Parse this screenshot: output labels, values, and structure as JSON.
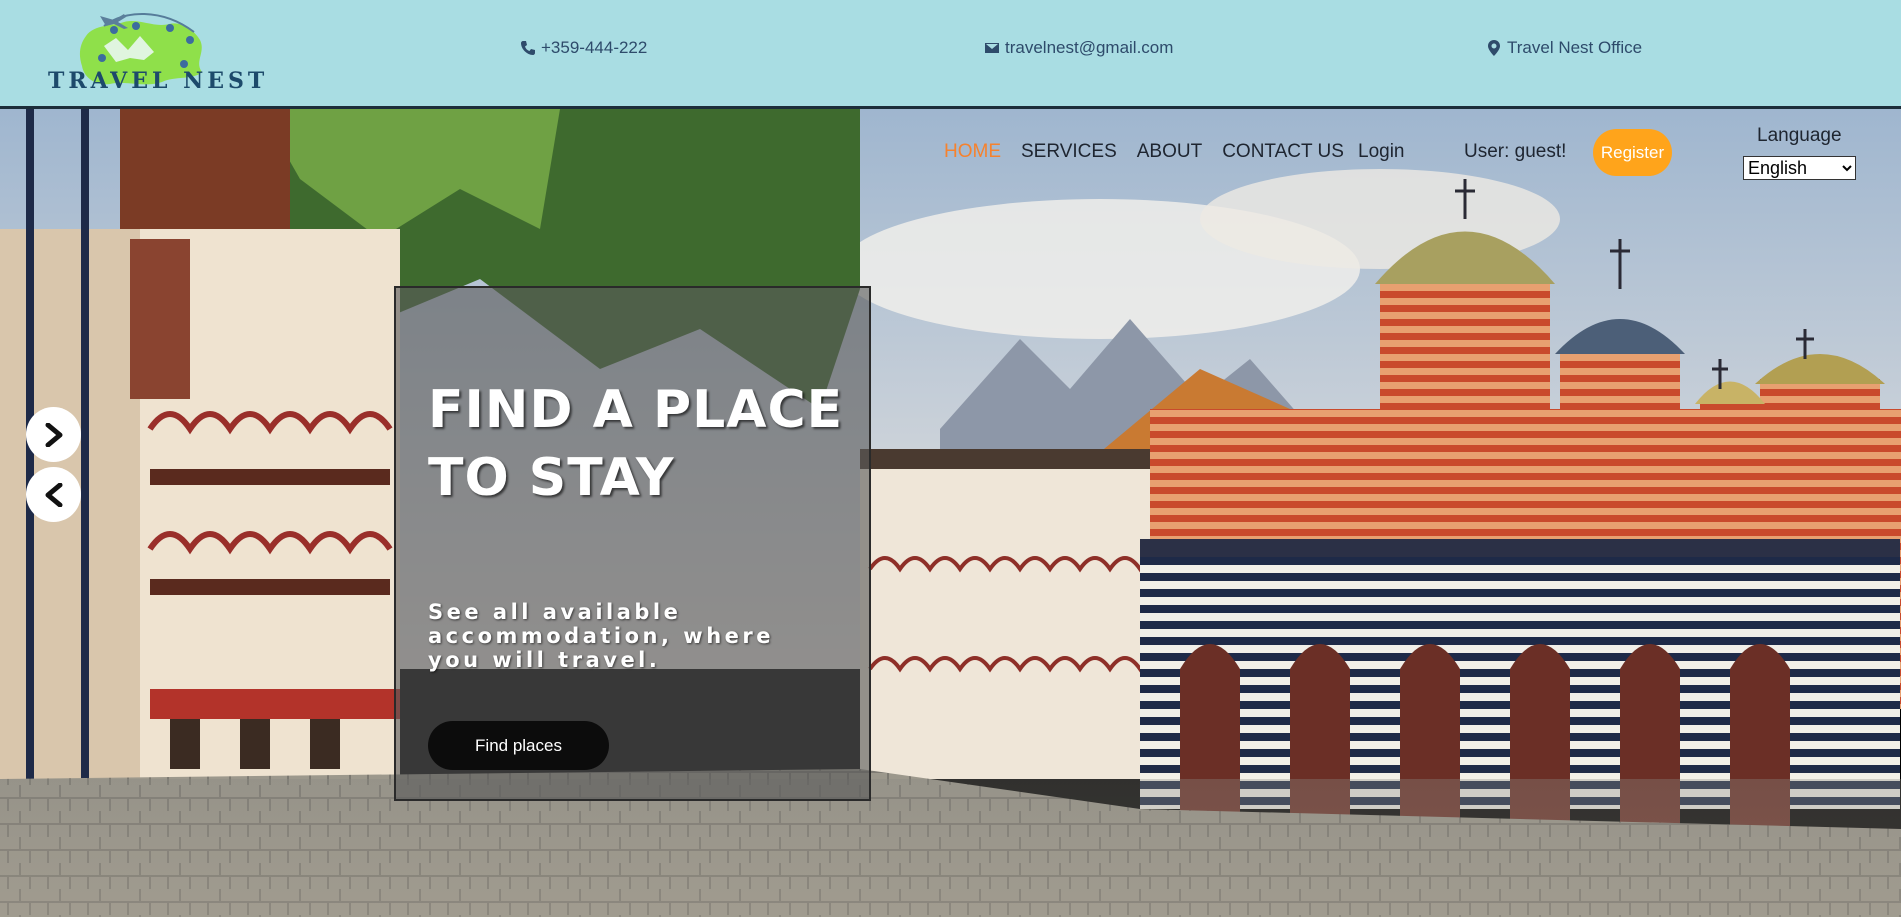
{
  "brand": {
    "name": "TRAVEL NEST"
  },
  "contacts": {
    "phone": "+359-444-222",
    "email": "travelnest@gmail.com",
    "office": "Travel Nest Office"
  },
  "nav": {
    "items": [
      "HOME",
      "SERVICES",
      "ABOUT",
      "CONTACT US"
    ],
    "active": "HOME",
    "login": "Login",
    "user": "User: guest!",
    "register": "Register"
  },
  "language": {
    "label": "Language",
    "selected": "English"
  },
  "hero": {
    "title_line1": "FIND A PLACE",
    "title_line2": "TO STAY",
    "subtitle_line1": "See all available",
    "subtitle_line2": "accommodation, where",
    "subtitle_line3": "you will travel.",
    "button": "Find places"
  },
  "icons": {
    "phone": "phone-icon",
    "email": "envelope-icon",
    "office": "map-marker-icon",
    "next": "chevron-right-icon",
    "prev": "chevron-left-icon"
  },
  "colors": {
    "topbar": "#a9dde3",
    "accent_orange": "#f6822d",
    "register_bg": "#ffa41b",
    "text_dark": "#1e2530"
  }
}
